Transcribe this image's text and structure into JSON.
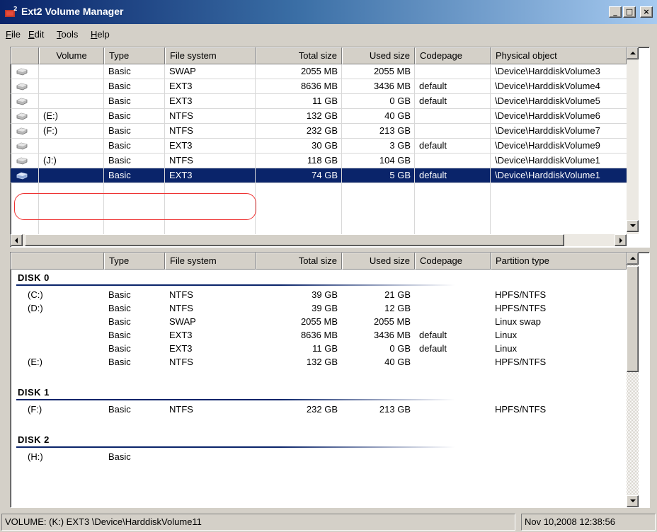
{
  "window": {
    "title": "Ext2 Volume Manager",
    "controls": {
      "minimize": "_",
      "maximize": "□",
      "close": "×"
    }
  },
  "menu": [
    {
      "label": "File",
      "mnemonic": "F",
      "rest": "ile"
    },
    {
      "label": "Edit",
      "mnemonic": "E",
      "rest": "dit"
    },
    {
      "label": "Tools",
      "mnemonic": "T",
      "rest": "ools"
    },
    {
      "label": "Help",
      "mnemonic": "H",
      "rest": "elp"
    }
  ],
  "volumes": {
    "columns": [
      "Volume",
      "Type",
      "File system",
      "Total size",
      "Used size",
      "Codepage",
      "Physical object"
    ],
    "rows": [
      {
        "volume": "",
        "type": "Basic",
        "fs": "SWAP",
        "total": "2055 MB",
        "used": "2055 MB",
        "codepage": "",
        "object": "\\Device\\HarddiskVolume3",
        "icon": "drive-icon"
      },
      {
        "volume": "",
        "type": "Basic",
        "fs": "EXT3",
        "total": "8636 MB",
        "used": "3436 MB",
        "codepage": "default",
        "object": "\\Device\\HarddiskVolume4",
        "icon": "drive-icon"
      },
      {
        "volume": "",
        "type": "Basic",
        "fs": "EXT3",
        "total": "11 GB",
        "used": "0 GB",
        "codepage": "default",
        "object": "\\Device\\HarddiskVolume5",
        "icon": "drive-icon"
      },
      {
        "volume": "(E:)",
        "type": "Basic",
        "fs": "NTFS",
        "total": "132 GB",
        "used": "40 GB",
        "codepage": "",
        "object": "\\Device\\HarddiskVolume6",
        "icon": "drive-icon"
      },
      {
        "volume": "(F:)",
        "type": "Basic",
        "fs": "NTFS",
        "total": "232 GB",
        "used": "213 GB",
        "codepage": "",
        "object": "\\Device\\HarddiskVolume7",
        "icon": "drive-icon"
      },
      {
        "volume": "",
        "type": "Basic",
        "fs": "EXT3",
        "total": "30 GB",
        "used": "3 GB",
        "codepage": "default",
        "object": "\\Device\\HarddiskVolume9",
        "icon": "drive-icon"
      },
      {
        "volume": "(J:)",
        "type": "Basic",
        "fs": "NTFS",
        "total": "118 GB",
        "used": "104 GB",
        "codepage": "",
        "object": "\\Device\\HarddiskVolume1",
        "icon": "drive-icon"
      },
      {
        "volume": "",
        "type": "Basic",
        "fs": "EXT3",
        "total": "74 GB",
        "used": "5 GB",
        "codepage": "default",
        "object": "\\Device\\HarddiskVolume1",
        "icon": "drive-icon",
        "selected": true
      }
    ]
  },
  "disks": {
    "columns": [
      "",
      "Type",
      "File system",
      "Total size",
      "Used size",
      "Codepage",
      "Partition type"
    ],
    "groups": [
      {
        "label": "DISK 0",
        "rows": [
          {
            "volume": "(C:)",
            "type": "Basic",
            "fs": "NTFS",
            "total": "39 GB",
            "used": "21 GB",
            "codepage": "",
            "ptype": "HPFS/NTFS"
          },
          {
            "volume": "(D:)",
            "type": "Basic",
            "fs": "NTFS",
            "total": "39 GB",
            "used": "12 GB",
            "codepage": "",
            "ptype": "HPFS/NTFS"
          },
          {
            "volume": "",
            "type": "Basic",
            "fs": "SWAP",
            "total": "2055 MB",
            "used": "2055 MB",
            "codepage": "",
            "ptype": "Linux swap"
          },
          {
            "volume": "",
            "type": "Basic",
            "fs": "EXT3",
            "total": "8636 MB",
            "used": "3436 MB",
            "codepage": "default",
            "ptype": "Linux"
          },
          {
            "volume": "",
            "type": "Basic",
            "fs": "EXT3",
            "total": "11 GB",
            "used": "0 GB",
            "codepage": "default",
            "ptype": "Linux"
          },
          {
            "volume": "(E:)",
            "type": "Basic",
            "fs": "NTFS",
            "total": "132 GB",
            "used": "40 GB",
            "codepage": "",
            "ptype": "HPFS/NTFS"
          }
        ]
      },
      {
        "label": "DISK 1",
        "rows": [
          {
            "volume": "(F:)",
            "type": "Basic",
            "fs": "NTFS",
            "total": "232 GB",
            "used": "213 GB",
            "codepage": "",
            "ptype": "HPFS/NTFS"
          }
        ]
      },
      {
        "label": "DISK 2",
        "rows": [
          {
            "volume": "(H:)",
            "type": "Basic",
            "fs": "",
            "total": "",
            "used": "",
            "codepage": "",
            "ptype": ""
          }
        ]
      }
    ]
  },
  "status": {
    "left": "VOLUME: (K:) EXT3 \\Device\\HarddiskVolume11",
    "right": "Nov 10,2008 12:38:56"
  },
  "colors": {
    "selection": "#0a246a",
    "highlight_oval": "#e33333"
  }
}
